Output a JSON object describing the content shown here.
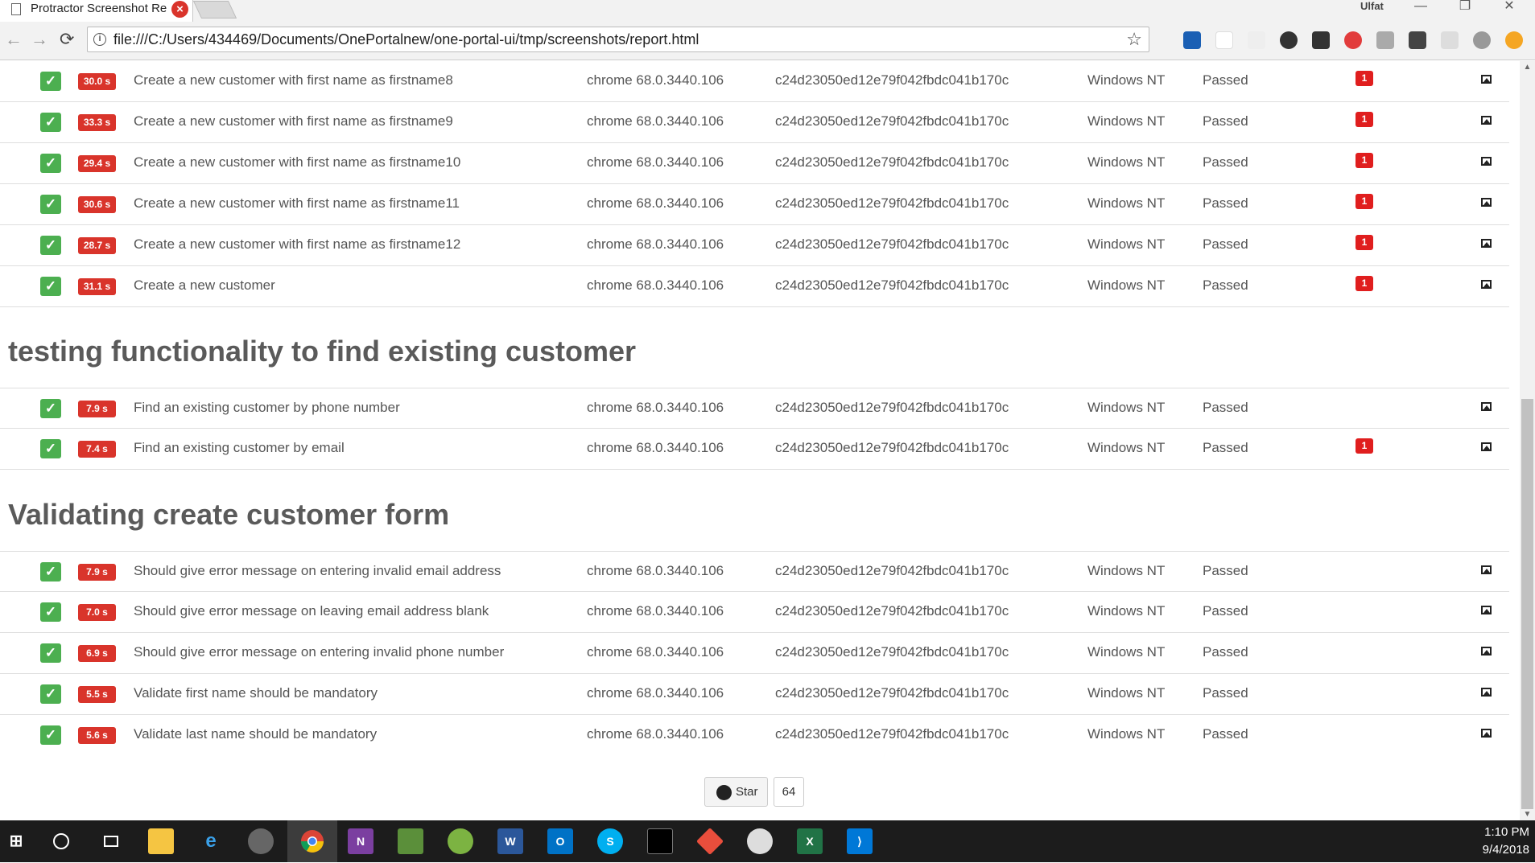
{
  "browser": {
    "tab_title": "Protractor Screenshot Re",
    "user": "Ulfat",
    "url": "file:///C:/Users/434469/Documents/OnePortalnew/one-portal-ui/tmp/screenshots/report.html",
    "info_glyph": "i",
    "star_glyph": "☆",
    "close_glyph": "×",
    "back_glyph": "←",
    "forward_glyph": "→",
    "reload_glyph": "⟳",
    "minimize_glyph": "—",
    "restore_glyph": "❐",
    "window_close_glyph": "✕"
  },
  "report": {
    "pass_glyph": "✓",
    "sections": [
      {
        "title": "",
        "rows": [
          {
            "duration": "30.0 s",
            "description": "Create a new customer with first name as firstname8",
            "browser": "chrome 68.0.3440.106",
            "session": "c24d23050ed12e79f042fbdc041b170c",
            "platform": "Windows NT",
            "status": "Passed",
            "log_count": "1"
          },
          {
            "duration": "33.3 s",
            "description": "Create a new customer with first name as firstname9",
            "browser": "chrome 68.0.3440.106",
            "session": "c24d23050ed12e79f042fbdc041b170c",
            "platform": "Windows NT",
            "status": "Passed",
            "log_count": "1"
          },
          {
            "duration": "29.4 s",
            "description": "Create a new customer with first name as firstname10",
            "browser": "chrome 68.0.3440.106",
            "session": "c24d23050ed12e79f042fbdc041b170c",
            "platform": "Windows NT",
            "status": "Passed",
            "log_count": "1"
          },
          {
            "duration": "30.6 s",
            "description": "Create a new customer with first name as firstname11",
            "browser": "chrome 68.0.3440.106",
            "session": "c24d23050ed12e79f042fbdc041b170c",
            "platform": "Windows NT",
            "status": "Passed",
            "log_count": "1"
          },
          {
            "duration": "28.7 s",
            "description": "Create a new customer with first name as firstname12",
            "browser": "chrome 68.0.3440.106",
            "session": "c24d23050ed12e79f042fbdc041b170c",
            "platform": "Windows NT",
            "status": "Passed",
            "log_count": "1"
          },
          {
            "duration": "31.1 s",
            "description": "Create a new customer",
            "browser": "chrome 68.0.3440.106",
            "session": "c24d23050ed12e79f042fbdc041b170c",
            "platform": "Windows NT",
            "status": "Passed",
            "log_count": "1"
          }
        ]
      },
      {
        "title": "testing functionality to find existing customer",
        "rows": [
          {
            "duration": "7.9 s",
            "description": "Find an existing customer by phone number",
            "browser": "chrome 68.0.3440.106",
            "session": "c24d23050ed12e79f042fbdc041b170c",
            "platform": "Windows NT",
            "status": "Passed",
            "log_count": ""
          },
          {
            "duration": "7.4 s",
            "description": "Find an existing customer by email",
            "browser": "chrome 68.0.3440.106",
            "session": "c24d23050ed12e79f042fbdc041b170c",
            "platform": "Windows NT",
            "status": "Passed",
            "log_count": "1"
          }
        ]
      },
      {
        "title": "Validating create customer form",
        "rows": [
          {
            "duration": "7.9 s",
            "description": "Should give error message on entering invalid email address",
            "browser": "chrome 68.0.3440.106",
            "session": "c24d23050ed12e79f042fbdc041b170c",
            "platform": "Windows NT",
            "status": "Passed",
            "log_count": ""
          },
          {
            "duration": "7.0 s",
            "description": "Should give error message on leaving email address blank",
            "browser": "chrome 68.0.3440.106",
            "session": "c24d23050ed12e79f042fbdc041b170c",
            "platform": "Windows NT",
            "status": "Passed",
            "log_count": ""
          },
          {
            "duration": "6.9 s",
            "description": "Should give error message on entering invalid phone number",
            "browser": "chrome 68.0.3440.106",
            "session": "c24d23050ed12e79f042fbdc041b170c",
            "platform": "Windows NT",
            "status": "Passed",
            "log_count": ""
          },
          {
            "duration": "5.5 s",
            "description": "Validate first name should be mandatory",
            "browser": "chrome 68.0.3440.106",
            "session": "c24d23050ed12e79f042fbdc041b170c",
            "platform": "Windows NT",
            "status": "Passed",
            "log_count": ""
          },
          {
            "duration": "5.6 s",
            "description": "Validate last name should be mandatory",
            "browser": "chrome 68.0.3440.106",
            "session": "c24d23050ed12e79f042fbdc041b170c",
            "platform": "Windows NT",
            "status": "Passed",
            "log_count": ""
          }
        ]
      }
    ],
    "github": {
      "star_label": "Star",
      "star_count": "64"
    }
  },
  "taskbar": {
    "time": "1:10 PM",
    "date": "9/4/2018"
  },
  "colors": {
    "pass": "#4caf50",
    "duration_badge": "#d9342b",
    "log_badge": "#e01e1e"
  }
}
